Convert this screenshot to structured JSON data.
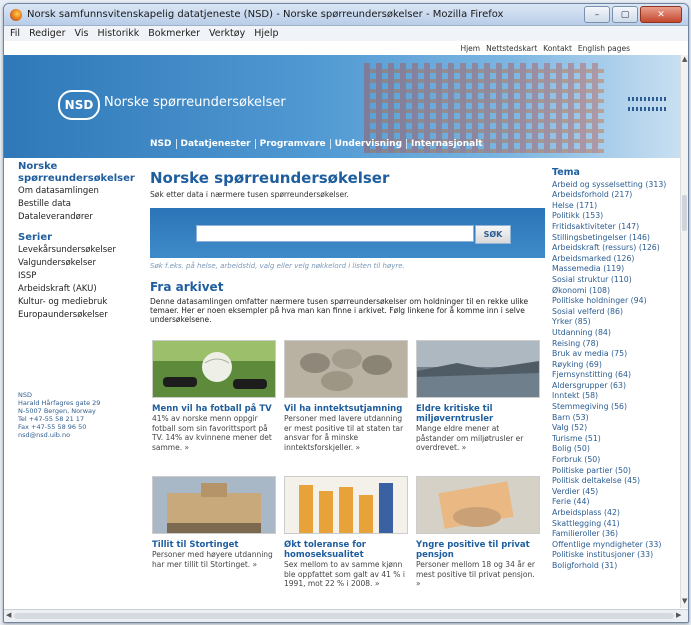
{
  "window": {
    "title": "Norsk samfunnsvitenskapelig datatjeneste (NSD) - Norske spørreundersøkelser - Mozilla Firefox"
  },
  "menubar": [
    "Fil",
    "Rediger",
    "Vis",
    "Historikk",
    "Bokmerker",
    "Verktøy",
    "Hjelp"
  ],
  "toplinks": [
    "Hjem",
    "Nettstedskart",
    "Kontakt",
    "English pages"
  ],
  "banner": {
    "logo": "NSD",
    "sitename": "Norske spørreundersøkelser"
  },
  "nav": [
    "NSD",
    "Datatjenester",
    "Programvare",
    "Undervisning",
    "Internasjonalt"
  ],
  "leftnav": {
    "heading1": "Norske spørreundersøkelser",
    "items1": [
      "Om datasamlingen",
      "Bestille data",
      "Dataleverandører"
    ],
    "heading2": "Serier",
    "items2": [
      "Levekårsundersøkelser",
      "Valgundersøkelser",
      "ISSP",
      "Arbeidskraft (AKU)",
      "Kultur- og mediebruk",
      "Europaundersøkelser"
    ]
  },
  "address": [
    "NSD",
    "Harald Hårfagres gate 29",
    "N-5007 Bergen, Norway",
    "Tel +47-55 58 21 17",
    "Fax +47-55 58 96 50",
    "nsd@nsd.uib.no"
  ],
  "main": {
    "title": "Norske spørreundersøkelser",
    "subtitle": "Søk etter data i nærmere tusen spørreundersøkelser.",
    "search_button": "SØK",
    "search_hint": "Søk f.eks. på helse, arbeidstid, valg eller velg nøkkelord i listen til høyre.",
    "section": "Fra arkivet",
    "intro": "Denne datasamlingen omfatter nærmere tusen spørreundersøkelser om holdninger til en rekke ulike temaer. Her er noen eksempler på hva man kan finne i arkivet. Følg linkene for å komme inn i selve undersøkelsene."
  },
  "cards": [
    {
      "title": "Menn vil ha fotball på TV",
      "text": "41% av norske menn oppgir fotball som sin favorittsport på TV. 14% av kvinnene mener det samme. »"
    },
    {
      "title": "Vil ha inntektsutjamning",
      "text": "Personer med lavere utdanning er mest positive til at staten tar ansvar for å minske inntektsforskjeller. »"
    },
    {
      "title": "Eldre kritiske til miljøverntrusler",
      "text": "Mange eldre mener at påstander om miljøtrusler er overdrevet. »"
    },
    {
      "title": "Tillit til Stortinget",
      "text": "Personer med høyere utdanning har mer tillit til Stortinget. »"
    },
    {
      "title": "Økt toleranse for homoseksualitet",
      "text": "Sex mellom to av samme kjønn ble oppfattet som galt av 41 % i 1991, mot 22 % i 2008. »"
    },
    {
      "title": "Yngre positive til privat pensjon",
      "text": "Personer mellom 18 og 34 år er mest positive til privat pensjon. »"
    }
  ],
  "tema": {
    "heading": "Tema",
    "items": [
      "Arbeid og sysselsetting (313)",
      "Arbeidsforhold (217)",
      "Helse (171)",
      "Politikk (153)",
      "Fritidsaktiviteter (147)",
      "Stillingsbetingelser (146)",
      "Arbeidskraft (ressurs) (126)",
      "Arbeidsmarked (126)",
      "Massemedia (119)",
      "Sosial struktur (110)",
      "Økonomi (108)",
      "Politiske holdninger (94)",
      "Sosial velferd (86)",
      "Yrker (85)",
      "Utdanning (84)",
      "Reising (78)",
      "Bruk av media (75)",
      "Røyking (69)",
      "Fjernsynstitting (64)",
      "Aldersgrupper (63)",
      "Inntekt (58)",
      "Stemmegiving (56)",
      "Barn (53)",
      "Valg (52)",
      "Turisme (51)",
      "Bolig (50)",
      "Forbruk (50)",
      "Politiske partier (50)",
      "Politisk deltakelse (45)",
      "Verdier (45)",
      "Ferie (44)",
      "Arbeidsplass (42)",
      "Skattlegging (41)",
      "Familieroller (36)",
      "Offentlige myndigheter (33)",
      "Politiske institusjoner (33)",
      "Boligforhold (31)"
    ]
  }
}
